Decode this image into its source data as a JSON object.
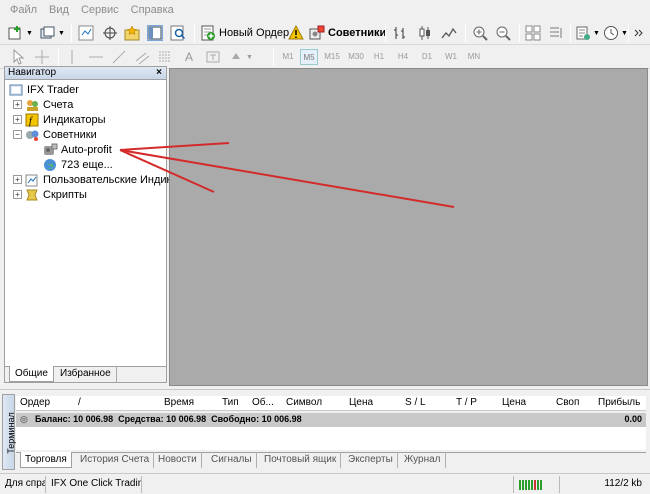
{
  "menu": [
    "Файл",
    "Вид",
    "Сервис",
    "Справка"
  ],
  "toolbar": {
    "new_order": "Новый Ордер",
    "advisors": "Советники",
    "timeframes": [
      "M1",
      "M5",
      "M15",
      "M30",
      "H1",
      "H4",
      "D1",
      "W1",
      "MN"
    ],
    "selected_timeframe": "M5"
  },
  "navigator": {
    "title": "Навигатор",
    "close": "×",
    "root": "IFX Trader",
    "items": [
      {
        "label": "Счета",
        "icon": "accounts-icon"
      },
      {
        "label": "Индикаторы",
        "icon": "indicators-icon"
      },
      {
        "label": "Советники",
        "icon": "experts-icon"
      },
      {
        "label": "Auto-profit",
        "icon": "expert-advisor-icon"
      },
      {
        "label": "723 еще...",
        "icon": "globe-icon"
      },
      {
        "label": "Пользовательские Индикаторы",
        "icon": "custom-indicators-icon"
      },
      {
        "label": "Скрипты",
        "icon": "scripts-icon"
      }
    ],
    "tabs": [
      "Общие",
      "Избранное"
    ]
  },
  "terminal": {
    "side_label": "Терминал",
    "columns": [
      "Ордер",
      "/",
      "Время",
      "Тип",
      "Об...",
      "Символ",
      "Цена",
      "S / L",
      "T / P",
      "Цена",
      "Своп",
      "Прибыль"
    ],
    "balance_row": "Баланс: 10 006.98  Средства: 10 006.98  Свободно: 10 006.98",
    "balance_profit": "0.00",
    "tabs": [
      "Торговля",
      "История Счета",
      "Новости",
      "Сигналы",
      "Почтовый ящик",
      "Эксперты",
      "Журнал"
    ]
  },
  "status": {
    "help": "Для спра",
    "profile": "IFX One Click Trading",
    "traffic": "112/2 kb"
  },
  "colors": {
    "chart_bg": "#aaaaaa",
    "annotation": "#d42a2a"
  }
}
